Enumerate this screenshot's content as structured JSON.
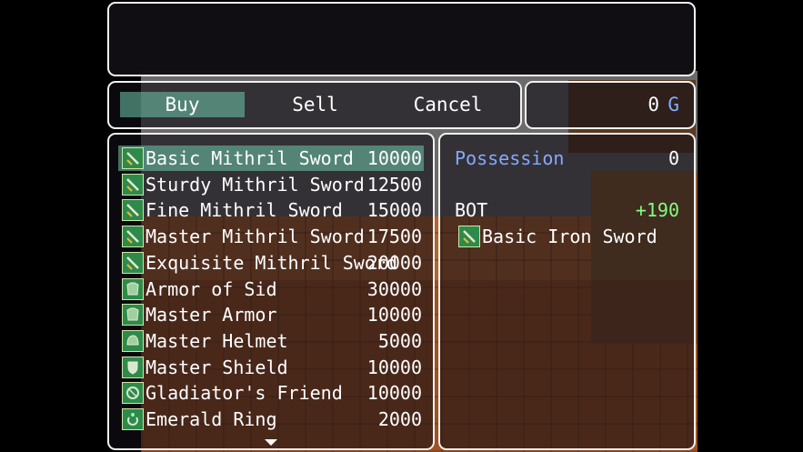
{
  "commands": {
    "buy": "Buy",
    "sell": "Sell",
    "cancel": "Cancel"
  },
  "gold": {
    "value": "0",
    "unit": "G"
  },
  "items": [
    {
      "name": "Basic Mithril Sword",
      "price": "10000",
      "icon": "sword-icon",
      "selected": true
    },
    {
      "name": "Sturdy Mithril Sword",
      "price": "12500",
      "icon": "sword-icon"
    },
    {
      "name": "Fine Mithril Sword",
      "price": "15000",
      "icon": "sword-icon"
    },
    {
      "name": "Master Mithril Sword",
      "price": "17500",
      "icon": "sword-icon"
    },
    {
      "name": "Exquisite Mithril Sword",
      "price": "20000",
      "icon": "sword-icon"
    },
    {
      "name": "Armor of Sid",
      "price": "30000",
      "icon": "armor-icon"
    },
    {
      "name": "Master Armor",
      "price": "10000",
      "icon": "armor-icon"
    },
    {
      "name": "Master Helmet",
      "price": "5000",
      "icon": "helmet-icon"
    },
    {
      "name": "Master Shield",
      "price": "10000",
      "icon": "shield-icon"
    },
    {
      "name": "Gladiator's Friend",
      "price": "10000",
      "icon": "accessory-icon"
    },
    {
      "name": "Emerald Ring",
      "price": "2000",
      "icon": "ring-icon"
    }
  ],
  "status": {
    "possession_label": "Possession",
    "possession_value": "0",
    "actor_name": "BOT",
    "param_change": "+190",
    "equipped_item": "Basic Iron Sword"
  },
  "colors": {
    "system_blue": "#84a9ff",
    "power_up_green": "#80ff80",
    "cursor": "#6ec8aa"
  }
}
